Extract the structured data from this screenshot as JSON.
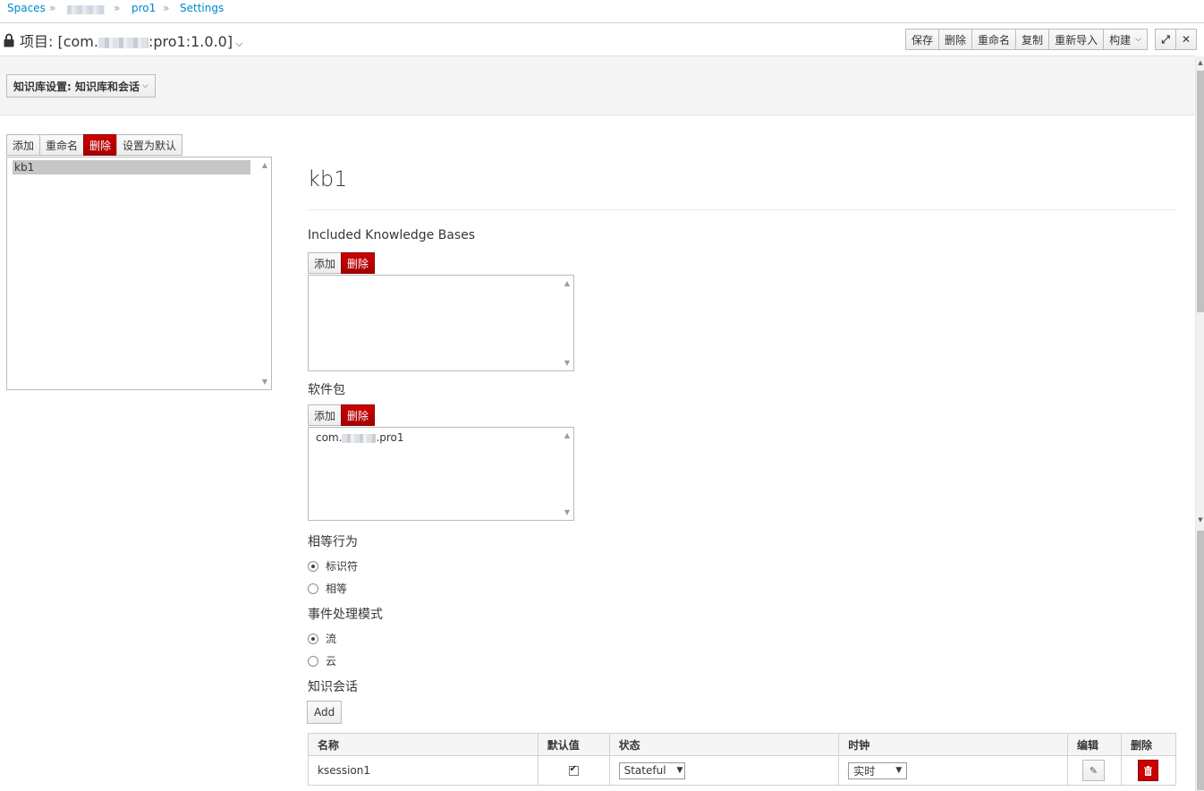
{
  "breadcrumb": {
    "spaces": "Spaces",
    "project": "pro1",
    "settings": "Settings",
    "separator": "»"
  },
  "header": {
    "title_prefix": "项目: [com.",
    "title_suffix": ":pro1:1.0.0]",
    "buttons": {
      "save": "保存",
      "delete": "删除",
      "rename": "重命名",
      "copy": "复制",
      "reimport": "重新导入",
      "build": "构建"
    }
  },
  "settings_dropdown": "知识库设置: 知识库和会话",
  "kb_list": {
    "buttons": {
      "add": "添加",
      "rename": "重命名",
      "delete": "删除",
      "set_default": "设置为默认"
    },
    "items": [
      "kb1"
    ]
  },
  "kb_detail": {
    "name": "kb1",
    "included_kb_label": "Included Knowledge Bases",
    "included_kb_buttons": {
      "add": "添加",
      "delete": "删除"
    },
    "packages_label": "软件包",
    "packages_buttons": {
      "add": "添加",
      "delete": "删除"
    },
    "packages": {
      "prefix": "com.",
      "suffix": ".pro1"
    },
    "equality_label": "相等行为",
    "equality_options": [
      {
        "label": "标识符",
        "checked": true
      },
      {
        "label": "相等",
        "checked": false
      }
    ],
    "event_label": "事件处理模式",
    "event_options": [
      {
        "label": "流",
        "checked": true
      },
      {
        "label": "云",
        "checked": false
      }
    ],
    "sessions_label": "知识会话",
    "add_session": "Add",
    "sessions_table": {
      "headers": [
        "名称",
        "默认值",
        "状态",
        "时钟",
        "编辑",
        "删除"
      ],
      "rows": [
        {
          "name": "ksession1",
          "default": true,
          "state": "Stateful",
          "clock": "实时"
        }
      ]
    }
  },
  "colors": {
    "link": "#0088ce",
    "danger": "#cc0000",
    "selected_row": "#c7c7c7"
  }
}
